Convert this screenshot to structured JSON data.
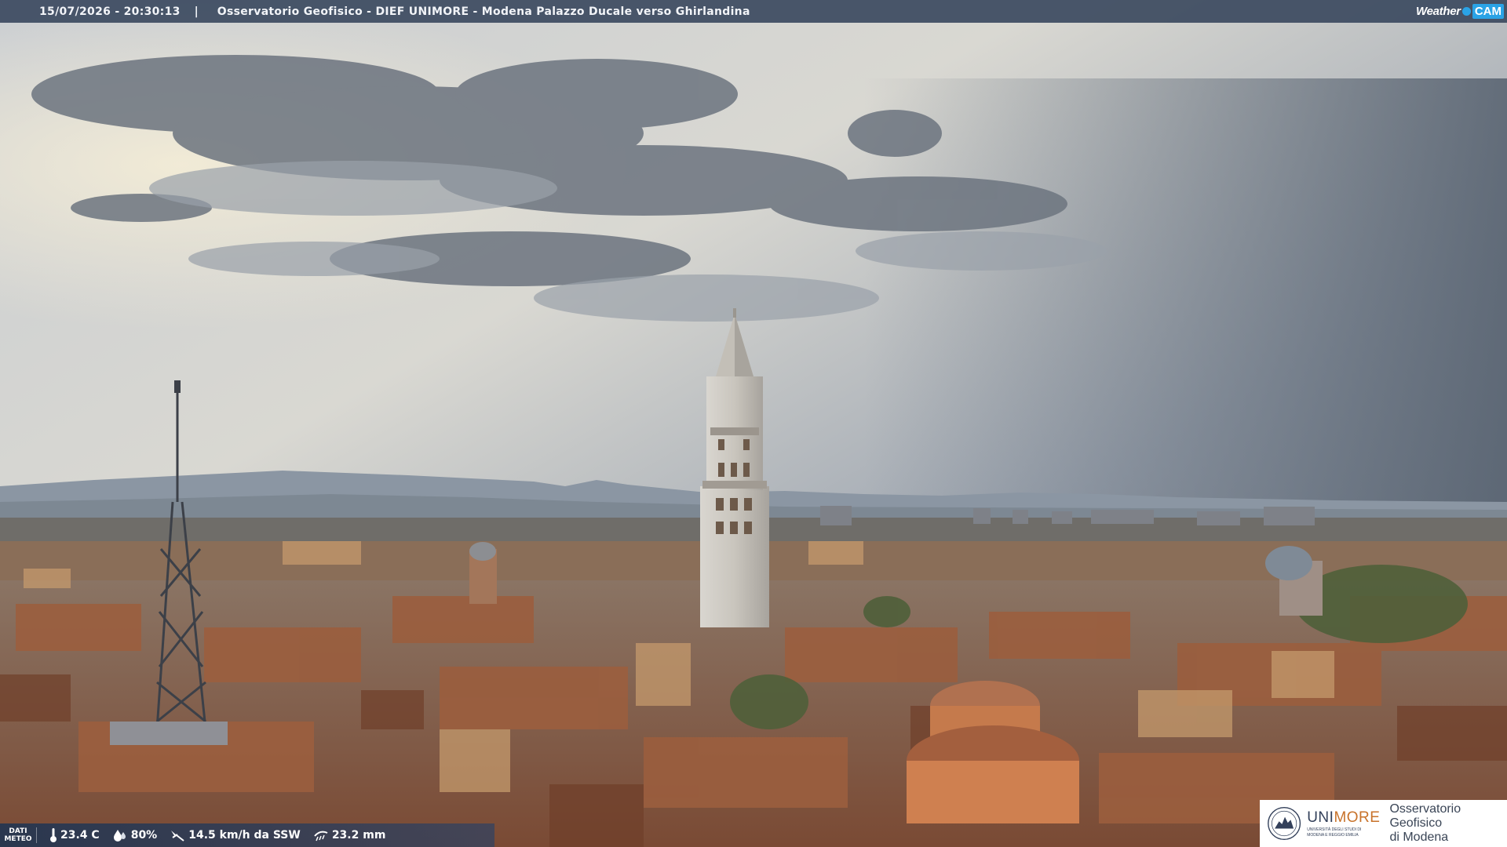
{
  "header": {
    "timestamp": "15/07/2026 - 20:30:13",
    "separator": "|",
    "caption": "Osservatorio Geofisico - DIEF UNIMORE - Modena Palazzo Ducale verso Ghirlandina",
    "brand_word": "Weather",
    "brand_cam": "CAM"
  },
  "meteo": {
    "label_line1": "DATI",
    "label_line2": "METEO",
    "temperature": "23.4 C",
    "humidity": "80%",
    "wind": "14.5 km/h da SSW",
    "rain": "23.2 mm",
    "icons": [
      "thermometer-icon",
      "humidity-drop-icon",
      "wind-icon",
      "rain-icon"
    ]
  },
  "logo": {
    "uni_part1": "UNI",
    "uni_part2": "MORE",
    "uni_sub1": "UNIVERSITÀ DEGLI STUDI DI",
    "uni_sub2": "MODENA E REGGIO EMILIA",
    "observatory_line1": "Osservatorio Geofisico",
    "observatory_line2": "di Modena"
  },
  "colors": {
    "bar": "#3c4a60",
    "brand_accent": "#2aa3e6",
    "unimore_orange": "#c8722a",
    "unimore_blue": "#33405a"
  }
}
